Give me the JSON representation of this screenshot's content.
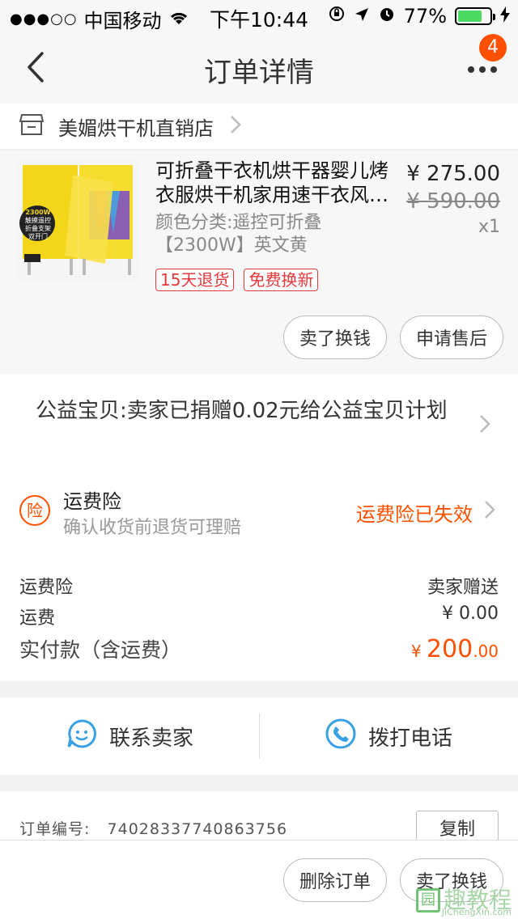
{
  "status_bar": {
    "carrier": "中国移动",
    "time": "下午10:44",
    "battery_percent": "77%",
    "battery_level": 0.77,
    "signal_dots": "●●●○○"
  },
  "nav": {
    "title": "订单详情",
    "badge": "4"
  },
  "shop": {
    "name": "美媚烘干机直销店"
  },
  "product": {
    "title": "可折叠干衣机烘干器婴儿烤衣服烘干机家用速干衣风…",
    "sku": "颜色分类:遥控可折叠【2300W】英文黄",
    "price": "¥ 275.00",
    "original_price": "¥ 590.00",
    "quantity": "x1",
    "tags": [
      "15天退货",
      "免费换新"
    ],
    "img_label_1": "2300W",
    "img_label_2": "触摸遥控",
    "img_label_3": "折叠支架",
    "img_label_4": "双开门",
    "btn_sell": "卖了换钱",
    "btn_aftersale": "申请售后"
  },
  "charity": {
    "text": "公益宝贝:卖家已捐赠0.02元给公益宝贝计划"
  },
  "insurance": {
    "icon_char": "险",
    "title": "运费险",
    "subtitle": "确认收货前退货可理赔",
    "status": "运费险已失效"
  },
  "fees": {
    "insurance_label": "运费险",
    "insurance_value": "卖家赠送",
    "shipping_label": "运费",
    "shipping_value": "¥ 0.00",
    "total_label": "实付款（含运费）",
    "total_currency": "¥ ",
    "total_int": "200",
    "total_dec": ".00"
  },
  "contact": {
    "seller_label": "联系卖家",
    "call_label": "拨打电话"
  },
  "order": {
    "number_label": "订单编号:",
    "number_value": "74028337740863756",
    "copy_label": "复制"
  },
  "bottom": {
    "delete_label": "删除订单",
    "sell_label": "卖了换钱"
  },
  "watermark": {
    "box_char": "园",
    "text": "趣教程",
    "sub": "JiChengXin.com"
  },
  "colors": {
    "accent": "#ff5000",
    "tag_red": "#e4393c",
    "contact_blue": "#3aa0e4"
  }
}
